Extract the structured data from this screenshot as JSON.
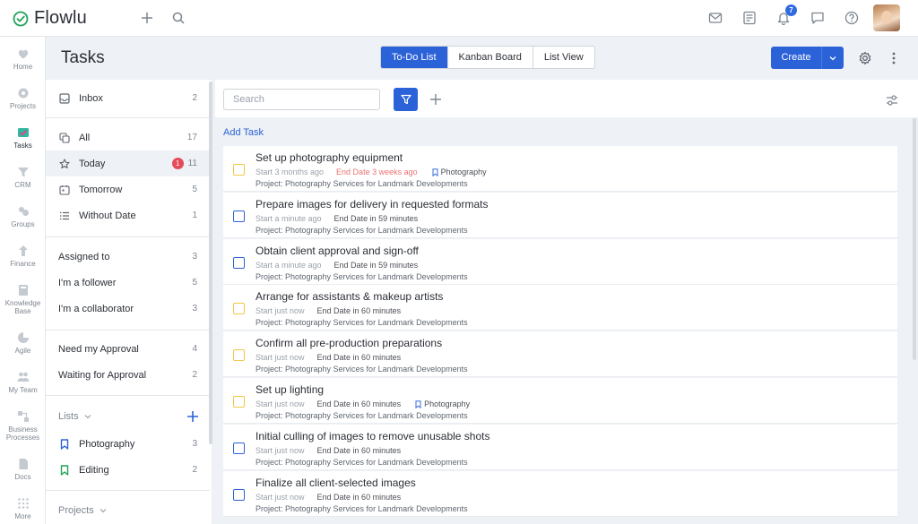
{
  "app": {
    "name": "Flowlu",
    "notifications_count": "7"
  },
  "leftnav": [
    {
      "label": "Home",
      "icon": "heart-icon"
    },
    {
      "label": "Projects",
      "icon": "projects-icon"
    },
    {
      "label": "Tasks",
      "icon": "tasks-icon"
    },
    {
      "label": "CRM",
      "icon": "crm-icon"
    },
    {
      "label": "Groups",
      "icon": "groups-icon"
    },
    {
      "label": "Finance",
      "icon": "finance-icon"
    },
    {
      "label": "Knowledge Base",
      "icon": "knowledge-base-icon"
    },
    {
      "label": "Agile",
      "icon": "agile-icon"
    },
    {
      "label": "My Team",
      "icon": "team-icon"
    },
    {
      "label": "Business Processes",
      "icon": "business-processes-icon"
    },
    {
      "label": "Docs",
      "icon": "docs-icon"
    },
    {
      "label": "More",
      "icon": "grid-icon"
    }
  ],
  "header": {
    "title": "Tasks",
    "tabs": [
      "To-Do List",
      "Kanban Board",
      "List View"
    ],
    "create_label": "Create"
  },
  "filters": {
    "inbox": {
      "label": "Inbox",
      "count": "2"
    },
    "all": {
      "label": "All",
      "count": "17"
    },
    "today": {
      "label": "Today",
      "badge": "1",
      "count": "11"
    },
    "tomorrow": {
      "label": "Tomorrow",
      "count": "5"
    },
    "without_date": {
      "label": "Without Date",
      "count": "1"
    },
    "assigned": {
      "label": "Assigned to",
      "count": "3"
    },
    "follower": {
      "label": "I'm a follower",
      "count": "5"
    },
    "collaborator": {
      "label": "I'm a collaborator",
      "count": "3"
    },
    "need_approval": {
      "label": "Need my Approval",
      "count": "4"
    },
    "waiting_approval": {
      "label": "Waiting for Approval",
      "count": "2"
    },
    "lists_title": "Lists",
    "photography": {
      "label": "Photography",
      "count": "3"
    },
    "editing": {
      "label": "Editing",
      "count": "2"
    },
    "projects_title": "Projects"
  },
  "toolbar": {
    "search_placeholder": "Search",
    "add_task": "Add Task"
  },
  "tasks": [
    {
      "title": "Set up photography equipment",
      "start": "Start 3 months ago",
      "end": "End Date 3 weeks ago",
      "tag": "Photography",
      "project": "Project: Photography Services for Landmark Developments"
    },
    {
      "title": "Prepare images for delivery in requested formats",
      "start": "Start a minute ago",
      "end": "End Date in 59 minutes",
      "tag": "",
      "project": "Project: Photography Services for Landmark Developments"
    },
    {
      "title": "Obtain client approval and sign-off",
      "start": "Start a minute ago",
      "end": "End Date in 59 minutes",
      "tag": "",
      "project": "Project: Photography Services for Landmark Developments"
    },
    {
      "title": "Arrange for assistants & makeup artists",
      "start": "Start just now",
      "end": "End Date in 60 minutes",
      "tag": "",
      "project": "Project: Photography Services for Landmark Developments"
    },
    {
      "title": "Confirm all pre-production preparations",
      "start": "Start just now",
      "end": "End Date in 60 minutes",
      "tag": "",
      "project": "Project: Photography Services for Landmark Developments"
    },
    {
      "title": "Set up lighting",
      "start": "Start just now",
      "end": "End Date in 60 minutes",
      "tag": "Photography",
      "project": "Project: Photography Services for Landmark Developments"
    },
    {
      "title": "Initial culling of images to remove unusable shots",
      "start": "Start just now",
      "end": "End Date in 60 minutes",
      "tag": "",
      "project": "Project: Photography Services for Landmark Developments"
    },
    {
      "title": "Finalize all client-selected images",
      "start": "Start just now",
      "end": "End Date in 60 minutes",
      "tag": "",
      "project": "Project: Photography Services for Landmark Developments"
    }
  ],
  "colors": {
    "accent": "#2c62d8",
    "overdue": "#e8595a",
    "badge": "#e44b5a",
    "checkbox_yellow": "#f2c744"
  }
}
